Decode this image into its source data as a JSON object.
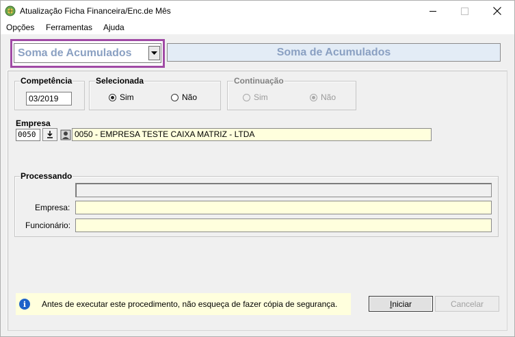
{
  "window": {
    "title": "Atualização Ficha Financeira/Enc.de Mês",
    "minimize_glyph": "—",
    "maximize_glyph": "☐",
    "close_glyph": "✕"
  },
  "menu": {
    "items": [
      "Opções",
      "Ferramentas",
      "Ajuda"
    ]
  },
  "header": {
    "combo_value": "Soma de Acumulados",
    "banner_title": "Soma de Acumulados",
    "highlight_color": "#a04aa5"
  },
  "competencia": {
    "label": "Competência",
    "value": "03/2019"
  },
  "selecionada": {
    "label": "Selecionada",
    "options": [
      {
        "label": "Sim",
        "checked": true
      },
      {
        "label": "Não",
        "checked": false
      }
    ]
  },
  "continuacao": {
    "label": "Continuação",
    "options": [
      {
        "label": "Sim",
        "checked": false
      },
      {
        "label": "Não",
        "checked": true
      }
    ]
  },
  "empresa": {
    "label": "Empresa",
    "code": "0050",
    "name": "0050 - EMPRESA TESTE CAIXA MATRIZ -  LTDA"
  },
  "processando": {
    "label": "Processando",
    "progress": 0,
    "empresa_label": "Empresa:",
    "empresa_value": "",
    "funcionario_label": "Funcionário:",
    "funcionario_value": ""
  },
  "info": {
    "text": "Antes de executar este procedimento, não esqueça de fazer cópia de segurança."
  },
  "buttons": {
    "iniciar": "Iniciar",
    "cancelar": "Cancelar"
  },
  "icons": {
    "app": "app-globe-icon",
    "dropdown": "dropdown-arrow-icon",
    "download": "download-arrow-icon",
    "search": "search-person-icon",
    "info": "info-icon"
  }
}
